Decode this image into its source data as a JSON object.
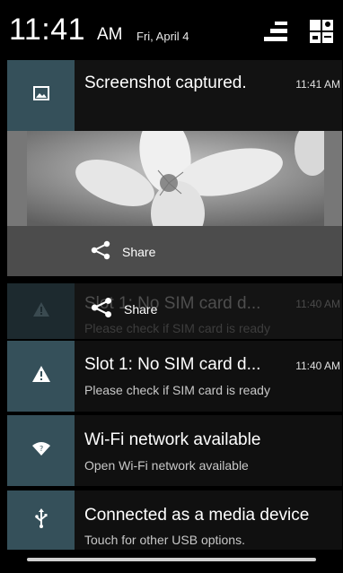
{
  "header": {
    "time": "11:41",
    "ampm": "AM",
    "date": "Fri, April 4",
    "icons": [
      "quick-settings-toggle-icon",
      "profile-icon"
    ]
  },
  "notifications": [
    {
      "id": "screenshot",
      "icon": "image-icon",
      "title": "Screenshot captured.",
      "time": "11:41 AM",
      "action": "Share"
    },
    {
      "id": "sim-swiping",
      "icon": "warning-icon",
      "title": "Slot 1: No SIM card d...",
      "subtitle": "Please check if SIM card is ready",
      "time": "11:40 AM",
      "action": "Share"
    },
    {
      "id": "sim",
      "icon": "warning-icon",
      "title": "Slot 1: No SIM card d...",
      "subtitle": "Please check if SIM card is ready",
      "time": "11:40 AM"
    },
    {
      "id": "wifi",
      "icon": "wifi-icon",
      "title": "Wi-Fi network available",
      "subtitle": "Open Wi-Fi network available"
    },
    {
      "id": "usb",
      "icon": "usb-icon",
      "title": "Connected as a media device",
      "subtitle": "Touch for other USB options."
    }
  ],
  "colors": {
    "icon_box": "#35505a",
    "background": "#000000",
    "notification_bg": "#101010"
  }
}
